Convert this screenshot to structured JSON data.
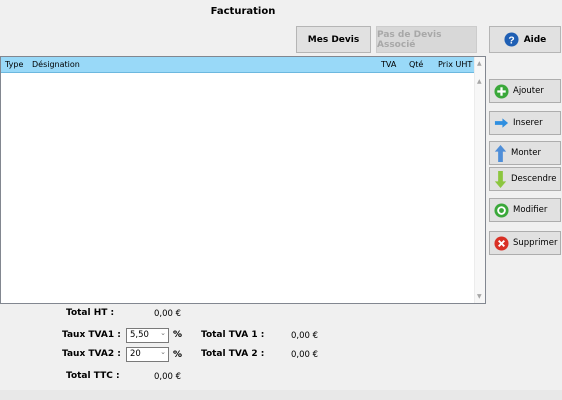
{
  "window": {
    "title": "Facturation"
  },
  "toolbar": {
    "mes_devis_label": "Mes Devis",
    "devis_associe_label": "Pas de Devis Associé",
    "aide_label": "Aide"
  },
  "table": {
    "columns": [
      "Type",
      "Désignation",
      "TVA",
      "Qté",
      "Prix UHT"
    ],
    "rows": []
  },
  "actions": {
    "ajouter": "Ajouter",
    "inserer": "Inserer",
    "monter": "Monter",
    "descendre": "Descendre",
    "modifier": "Modifier",
    "supprimer": "Supprimer"
  },
  "totals": {
    "total_ht_label": "Total   HT :",
    "total_ht_value": "0,00 €",
    "taux_tva1_label": "Taux TVA1 :",
    "taux_tva1_value": "5,50",
    "taux_tva2_label": "Taux TVA2 :",
    "taux_tva2_value": "20",
    "percent": "%",
    "total_tva1_label": "Total TVA 1 :",
    "total_tva1_value": "0,00 €",
    "total_tva2_label": "Total TVA 2 :",
    "total_tva2_value": "0,00 €",
    "total_ttc_label": "Total TTC :",
    "total_ttc_value": "0,00 €"
  },
  "icons": {
    "aide": "help-icon",
    "ajouter": "plus-icon",
    "inserer": "arrow-right-icon",
    "monter": "arrow-up-icon",
    "descendre": "arrow-down-icon",
    "modifier": "refresh-icon",
    "supprimer": "delete-icon"
  },
  "colors": {
    "header": "#99d9f8",
    "help_blue": "#1f5fb4",
    "add_green": "#3aa83a",
    "delete_red": "#d93025"
  }
}
